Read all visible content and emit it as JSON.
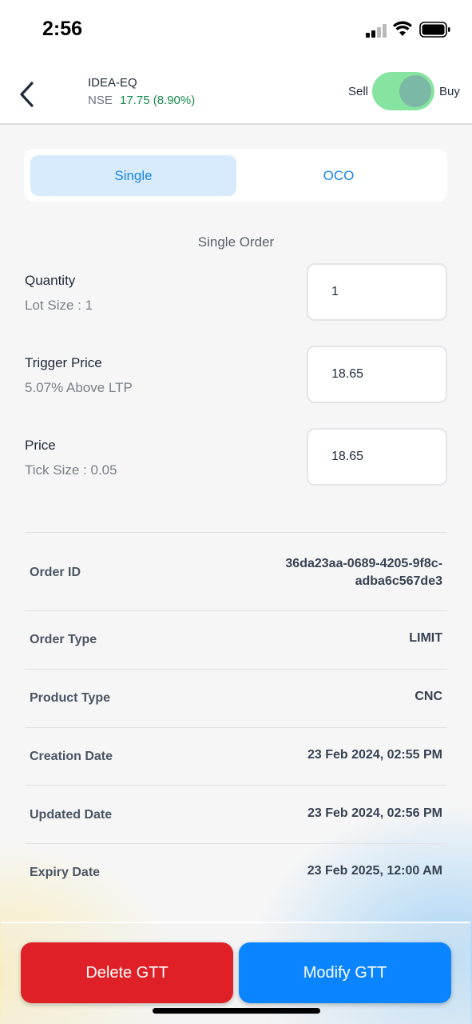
{
  "status_bar": {
    "time": "2:56"
  },
  "header": {
    "symbol": "IDEA-EQ",
    "exchange": "NSE",
    "ltp": "17.75 (8.90%)",
    "sell_label": "Sell",
    "buy_label": "Buy",
    "toggle_state": "Buy"
  },
  "tabs": [
    {
      "label": "Single",
      "active": true
    },
    {
      "label": "OCO",
      "active": false
    }
  ],
  "section_title": "Single Order",
  "fields": {
    "quantity": {
      "label": "Quantity",
      "sub": "Lot Size : 1",
      "value": "1"
    },
    "trigger_price": {
      "label": "Trigger Price",
      "sub": "5.07% Above LTP",
      "value": "18.65"
    },
    "price": {
      "label": "Price",
      "sub": "Tick Size : 0.05",
      "value": "18.65"
    }
  },
  "details": {
    "order_id": {
      "label": "Order ID",
      "value_line1": "36da23aa-0689-4205-9f8c-",
      "value_line2": "adba6c567de3"
    },
    "order_type": {
      "label": "Order Type",
      "value": "LIMIT"
    },
    "product_type": {
      "label": "Product Type",
      "value": "CNC"
    },
    "creation_date": {
      "label": "Creation Date",
      "value": "23 Feb 2024, 02:55 PM"
    },
    "updated_date": {
      "label": "Updated Date",
      "value": "23 Feb 2024, 02:56 PM"
    },
    "expiry_date": {
      "label": "Expiry Date",
      "value": "23 Feb 2025, 12:00 AM"
    }
  },
  "actions": {
    "delete_label": "Delete GTT",
    "modify_label": "Modify GTT"
  },
  "colors": {
    "accent_blue": "#0a84ff",
    "delete_red": "#df2027",
    "positive_green": "#178a4c",
    "toggle_green": "#86e3a0"
  }
}
